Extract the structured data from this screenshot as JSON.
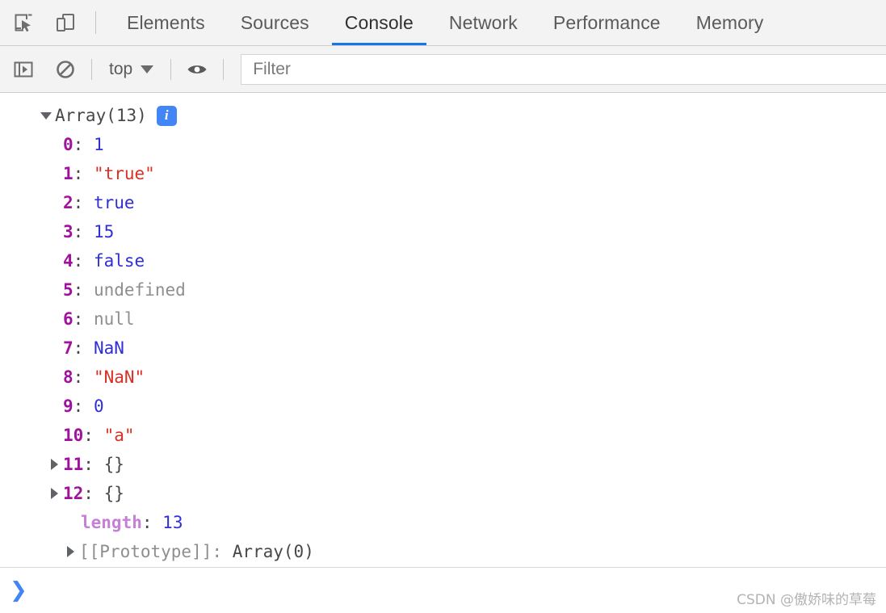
{
  "toolbar": {
    "inspect_icon": "inspect-element-icon",
    "device_icon": "device-toolbar-icon",
    "tabs": [
      {
        "label": "Elements",
        "active": false
      },
      {
        "label": "Sources",
        "active": false
      },
      {
        "label": "Console",
        "active": true
      },
      {
        "label": "Network",
        "active": false
      },
      {
        "label": "Performance",
        "active": false
      },
      {
        "label": "Memory",
        "active": false
      }
    ],
    "active_tab_underline_color": "#1a73e8"
  },
  "filterbar": {
    "sidebar_toggle_icon": "console-sidebar-toggle-icon",
    "clear_icon": "clear-console-icon",
    "context_label": "top",
    "eye_icon": "live-expression-eye-icon",
    "filter_placeholder": "Filter",
    "filter_value": ""
  },
  "console": {
    "root": {
      "expanded": true,
      "label": "Array(13)",
      "info_badge": "i"
    },
    "entries": [
      {
        "key": "0",
        "colon": ":",
        "value": "1",
        "type": "number",
        "expandable": false
      },
      {
        "key": "1",
        "colon": ":",
        "value": "\"true\"",
        "type": "string",
        "expandable": false
      },
      {
        "key": "2",
        "colon": ":",
        "value": "true",
        "type": "boolean",
        "expandable": false
      },
      {
        "key": "3",
        "colon": ":",
        "value": "15",
        "type": "number",
        "expandable": false
      },
      {
        "key": "4",
        "colon": ":",
        "value": "false",
        "type": "boolean",
        "expandable": false
      },
      {
        "key": "5",
        "colon": ":",
        "value": "undefined",
        "type": "undefined",
        "expandable": false
      },
      {
        "key": "6",
        "colon": ":",
        "value": "null",
        "type": "null",
        "expandable": false
      },
      {
        "key": "7",
        "colon": ":",
        "value": "NaN",
        "type": "number",
        "expandable": false
      },
      {
        "key": "8",
        "colon": ":",
        "value": "\"NaN\"",
        "type": "string",
        "expandable": false
      },
      {
        "key": "9",
        "colon": ":",
        "value": "0",
        "type": "number",
        "expandable": false
      },
      {
        "key": "10",
        "colon": ":",
        "value": "\"a\"",
        "type": "string",
        "expandable": false
      },
      {
        "key": "11",
        "colon": ":",
        "value": "{}",
        "type": "object",
        "expandable": true
      },
      {
        "key": "12",
        "colon": ":",
        "value": "{}",
        "type": "object",
        "expandable": true
      }
    ],
    "length_row": {
      "key": "length",
      "colon": ":",
      "value": "13",
      "type": "number"
    },
    "prototype_row": {
      "key": "[[Prototype]]",
      "colon": ":",
      "value": "Array(0)",
      "expandable": true
    }
  },
  "prompt": {
    "chevron": "❯",
    "input_value": ""
  },
  "watermark": {
    "text": "CSDN @傲娇味的草莓"
  },
  "colors": {
    "chrome_bg": "#f3f3f3",
    "accent_blue": "#1a73e8",
    "key_purple": "#a0119e",
    "string_red": "#d93025",
    "number_blue": "#2f2fd4",
    "muted_grey": "#8e8e8e",
    "length_violet": "#c780d8"
  }
}
